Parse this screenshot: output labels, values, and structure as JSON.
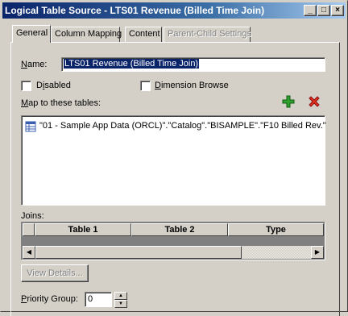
{
  "window": {
    "title": "Logical Table Source - LTS01 Revenue (Billed Time Join)",
    "controls": {
      "minimize": "_",
      "maximize": "□",
      "close": "×"
    }
  },
  "tabs": [
    {
      "label": "General",
      "state": "active"
    },
    {
      "label": "Column Mapping",
      "state": "normal"
    },
    {
      "label": "Content",
      "state": "normal"
    },
    {
      "label": "Parent-Child Settings",
      "state": "disabled"
    }
  ],
  "general": {
    "name_label_first": "N",
    "name_label_rest": "ame:",
    "name_value": "LTS01 Revenue (Billed Time Join)",
    "disabled_label_pre": "D",
    "disabled_label_ul": "i",
    "disabled_label_post": "sabled",
    "disabled_checked": false,
    "dimension_browse_label_ul": "D",
    "dimension_browse_label_post": "imension Browse",
    "dimension_browse_checked": false,
    "map_label_ul": "M",
    "map_label_post": "ap to these tables:",
    "add_icon": "green-plus-icon",
    "remove_icon": "red-x-icon",
    "mapped_tables": [
      {
        "icon": "table-icon",
        "text": "\"01 - Sample App Data (ORCL)\".\"Catalog\".\"BISAMPLE\".\"F10 Billed Rev.\""
      }
    ],
    "joins_label": "Joins:",
    "joins_columns": [
      "Table 1",
      "Table 2",
      "Type"
    ],
    "view_details_label": "View Details...",
    "priority_label_ul": "P",
    "priority_label_post": "riority Group:",
    "priority_value": "0"
  }
}
